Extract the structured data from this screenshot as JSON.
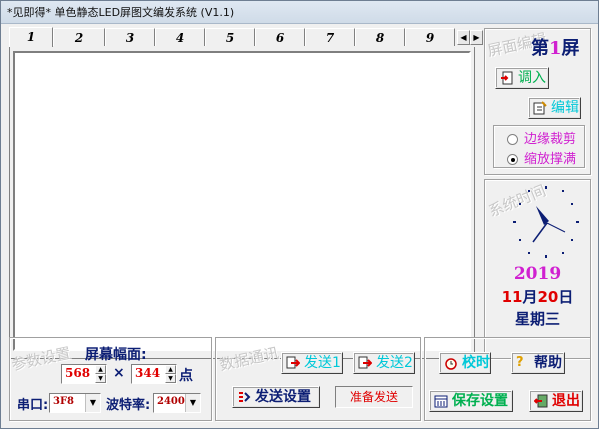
{
  "window": {
    "title": "*见即得* 单色静态LED屏图文编发系统 (V1.1)"
  },
  "tabs": {
    "items": [
      "1",
      "2",
      "3",
      "4",
      "5",
      "6",
      "7",
      "8",
      "9"
    ],
    "active": "1"
  },
  "screen_edit": {
    "watermark": "屏面编辑",
    "screen_prefix": "第",
    "screen_number": "1",
    "screen_suffix": "屏",
    "import_label": "调入",
    "edit_label": "编辑",
    "radio_options": [
      "边缘裁剪",
      "缩放撑满"
    ],
    "radio_selected": "缩放撑满"
  },
  "system_time": {
    "watermark": "系统时间",
    "year": "2019",
    "month": "11",
    "month_suffix": "月",
    "day": "20",
    "day_suffix": "日",
    "weekday": "星期三",
    "clock": {
      "hour": 7,
      "minute": 19
    }
  },
  "params": {
    "watermark": "参数设置",
    "screen_size_label": "屏幕幅面:",
    "width": "568",
    "times": "×",
    "height": "344",
    "unit": "点",
    "port_label": "串口:",
    "port_value": "3F8",
    "baud_label": "波特率:",
    "baud_value": "2400"
  },
  "comm": {
    "watermark": "数据通讯",
    "send1": "发送1",
    "send2": "发送2",
    "send_settings": "发送设置",
    "status": "准备发送"
  },
  "actions": {
    "calibrate": "校时",
    "help": "帮助",
    "save": "保存设置",
    "exit": "退出"
  },
  "colors": {
    "cyan_text": "#00c8d8",
    "magenta": "#d020d0",
    "red": "#e00000",
    "navy": "#0c1e74",
    "green": "#00b050"
  }
}
